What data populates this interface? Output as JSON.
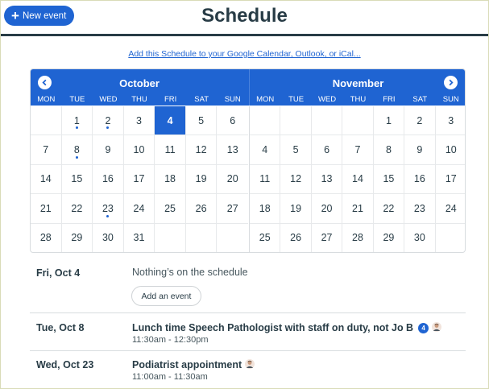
{
  "header": {
    "new_event_label": "New event",
    "title": "Schedule"
  },
  "subscribe_link": "Add this Schedule to your Google Calendar, Outlook, or iCal...",
  "calendar": {
    "dow": [
      "MON",
      "TUE",
      "WED",
      "THU",
      "FRI",
      "SAT",
      "SUN"
    ],
    "months": [
      {
        "name": "October",
        "days": [
          "",
          "1",
          "2",
          "3",
          "4",
          "5",
          "6",
          "7",
          "8",
          "9",
          "10",
          "11",
          "12",
          "13",
          "14",
          "15",
          "16",
          "17",
          "18",
          "19",
          "20",
          "21",
          "22",
          "23",
          "24",
          "25",
          "26",
          "27",
          "28",
          "29",
          "30",
          "31",
          "",
          "",
          ""
        ],
        "selected_day": "4",
        "event_days": [
          "1",
          "2",
          "8",
          "23"
        ]
      },
      {
        "name": "November",
        "days": [
          "",
          "",
          "",
          "",
          "1",
          "2",
          "3",
          "4",
          "5",
          "6",
          "7",
          "8",
          "9",
          "10",
          "11",
          "12",
          "13",
          "14",
          "15",
          "16",
          "17",
          "18",
          "19",
          "20",
          "21",
          "22",
          "23",
          "24",
          "25",
          "26",
          "27",
          "28",
          "29",
          "30",
          ""
        ],
        "selected_day": "",
        "event_days": []
      }
    ]
  },
  "agenda": {
    "selected": {
      "date": "Fri, Oct 4",
      "message": "Nothing’s on the schedule",
      "add_label": "Add an event"
    },
    "events": [
      {
        "date": "Tue, Oct 8",
        "title": "Lunch time Speech Pathologist with staff on duty, not Jo B",
        "badge": "4",
        "time": "11:30am - 12:30pm"
      },
      {
        "date": "Wed, Oct 23",
        "title": "Podiatrist appointment",
        "time": "11:00am - 11:30am"
      }
    ]
  },
  "colors": {
    "accent": "#1f64d2",
    "text": "#283c46"
  },
  "icons": {
    "new_event": "plus-icon",
    "prev": "chevron-left-icon",
    "next": "chevron-right-icon",
    "avatar": "person-avatar-icon"
  }
}
